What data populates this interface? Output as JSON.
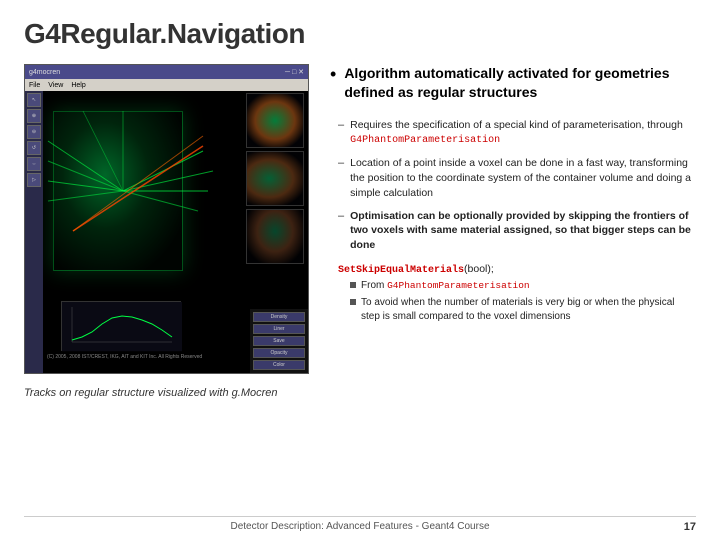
{
  "slide": {
    "title": "G4Regular.Navigation",
    "footer_text": "Detector Description: Advanced Features - Geant4 Course",
    "page_number": "17"
  },
  "screenshot": {
    "window_title": "g4mocren",
    "menu_items": [
      "File",
      "View",
      "Help"
    ],
    "copyright": "(C) 2005, 2008 IST/CREST, IKG, AIT and KIT Inc.  All Rights Reserved",
    "caption": "Tracks on regular structure visualized with g.Mocren"
  },
  "bullet": {
    "main_text": "Algorithm automatically activated for geometries defined as regular structures",
    "sub_items": [
      {
        "dash": "–",
        "text_parts": [
          {
            "type": "normal",
            "text": "Requires the specification of a special kind of  parameterisation, through "
          },
          {
            "type": "code",
            "text": "G4PhantomParameterisation"
          }
        ]
      },
      {
        "dash": "–",
        "text_parts": [
          {
            "type": "normal",
            "text": "Location of a point inside a voxel can be done in a fast way, transforming the position to the coordinate system of the container volume and doing a simple calculation"
          }
        ]
      },
      {
        "dash": "–",
        "text_parts": [
          {
            "type": "bold",
            "text": "Optimisation can be optionally provided by skipping the frontiers of two voxels with same material assigned, so that bigger steps can be done"
          }
        ]
      }
    ],
    "set_skip": {
      "label_code": "SetSkipEqualMaterials",
      "label_suffix": "(bool);"
    },
    "sub_bullets": [
      {
        "text_parts": [
          {
            "type": "normal",
            "text": "From "
          },
          {
            "type": "code",
            "text": "G4PhantomParameterisation"
          }
        ]
      },
      {
        "text_parts": [
          {
            "type": "normal",
            "text": "To avoid when the number of materials is very big or when the physical step is small compared to the voxel dimensions"
          }
        ]
      }
    ]
  }
}
